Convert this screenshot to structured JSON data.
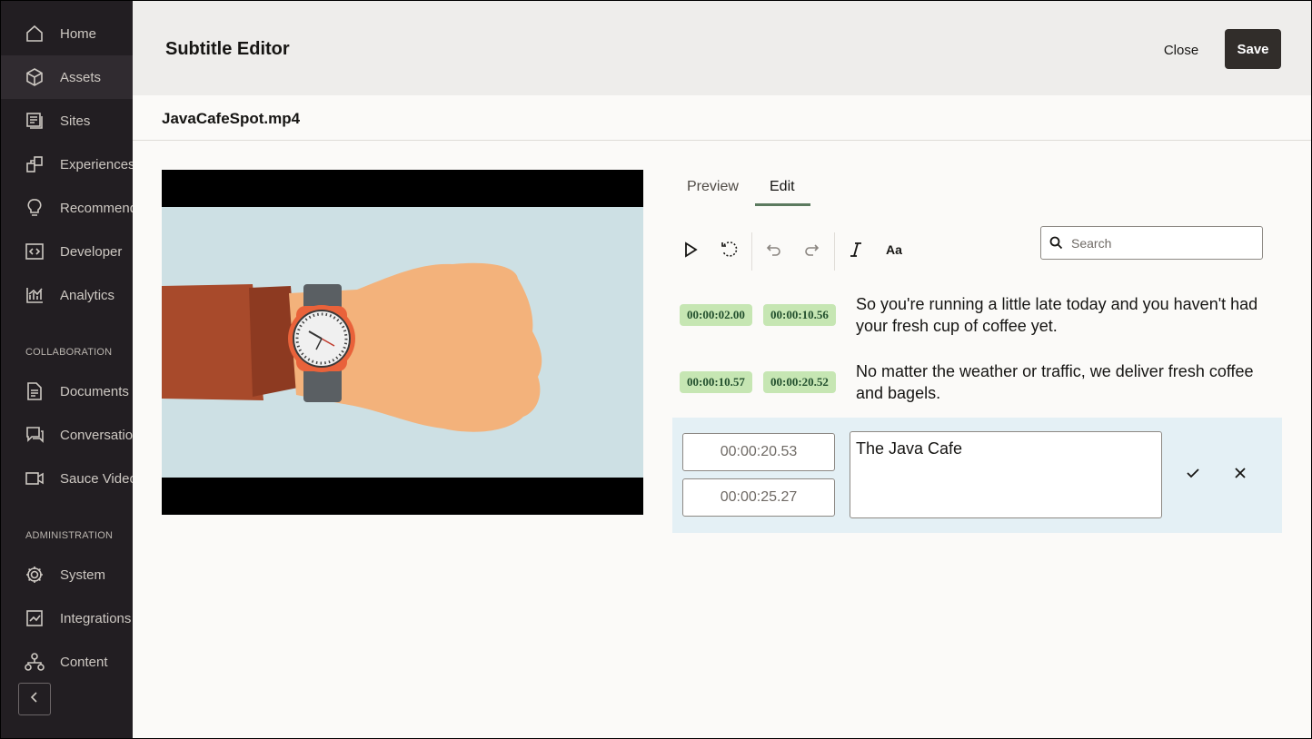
{
  "sidebar": {
    "items": [
      {
        "label": "Home",
        "icon": "home-icon"
      },
      {
        "label": "Assets",
        "icon": "assets-cube-icon"
      },
      {
        "label": "Sites",
        "icon": "sites-icon"
      },
      {
        "label": "Experiences",
        "icon": "experiences-icon"
      },
      {
        "label": "Recommendations",
        "icon": "lightbulb-icon"
      },
      {
        "label": "Developer",
        "icon": "developer-icon"
      },
      {
        "label": "Analytics",
        "icon": "analytics-icon"
      }
    ],
    "collaboration_heading": "COLLABORATION",
    "collaboration_items": [
      {
        "label": "Documents",
        "icon": "documents-icon"
      },
      {
        "label": "Conversations",
        "icon": "conversations-icon"
      },
      {
        "label": "Sauce Video",
        "icon": "video-camera-icon"
      }
    ],
    "administration_heading": "ADMINISTRATION",
    "administration_items": [
      {
        "label": "System",
        "icon": "gear-icon"
      },
      {
        "label": "Integrations",
        "icon": "integrations-icon"
      },
      {
        "label": "Content",
        "icon": "content-tree-icon"
      }
    ]
  },
  "header": {
    "title": "Subtitle Editor",
    "close_label": "Close",
    "save_label": "Save"
  },
  "file": {
    "name": "JavaCafeSpot.mp4"
  },
  "tabs": [
    {
      "label": "Preview",
      "active": false
    },
    {
      "label": "Edit",
      "active": true
    }
  ],
  "search": {
    "placeholder": "Search"
  },
  "subtitles": [
    {
      "start": "00:00:02.00",
      "end": "00:00:10.56",
      "text": "So you're running a little late today and you haven't had your fresh cup of coffee yet."
    },
    {
      "start": "00:00:10.57",
      "end": "00:00:20.52",
      "text": "No matter the weather or traffic, we deliver fresh coffee and bagels."
    }
  ],
  "editing": {
    "start": "00:00:20.53",
    "end": "00:00:25.27",
    "text": "The Java Cafe"
  },
  "colors": {
    "sidebar_bg": "#221e22",
    "badge_bg": "#c6e6b3",
    "save_bg": "#312d2a",
    "edit_row_bg": "#e4f0f5"
  }
}
